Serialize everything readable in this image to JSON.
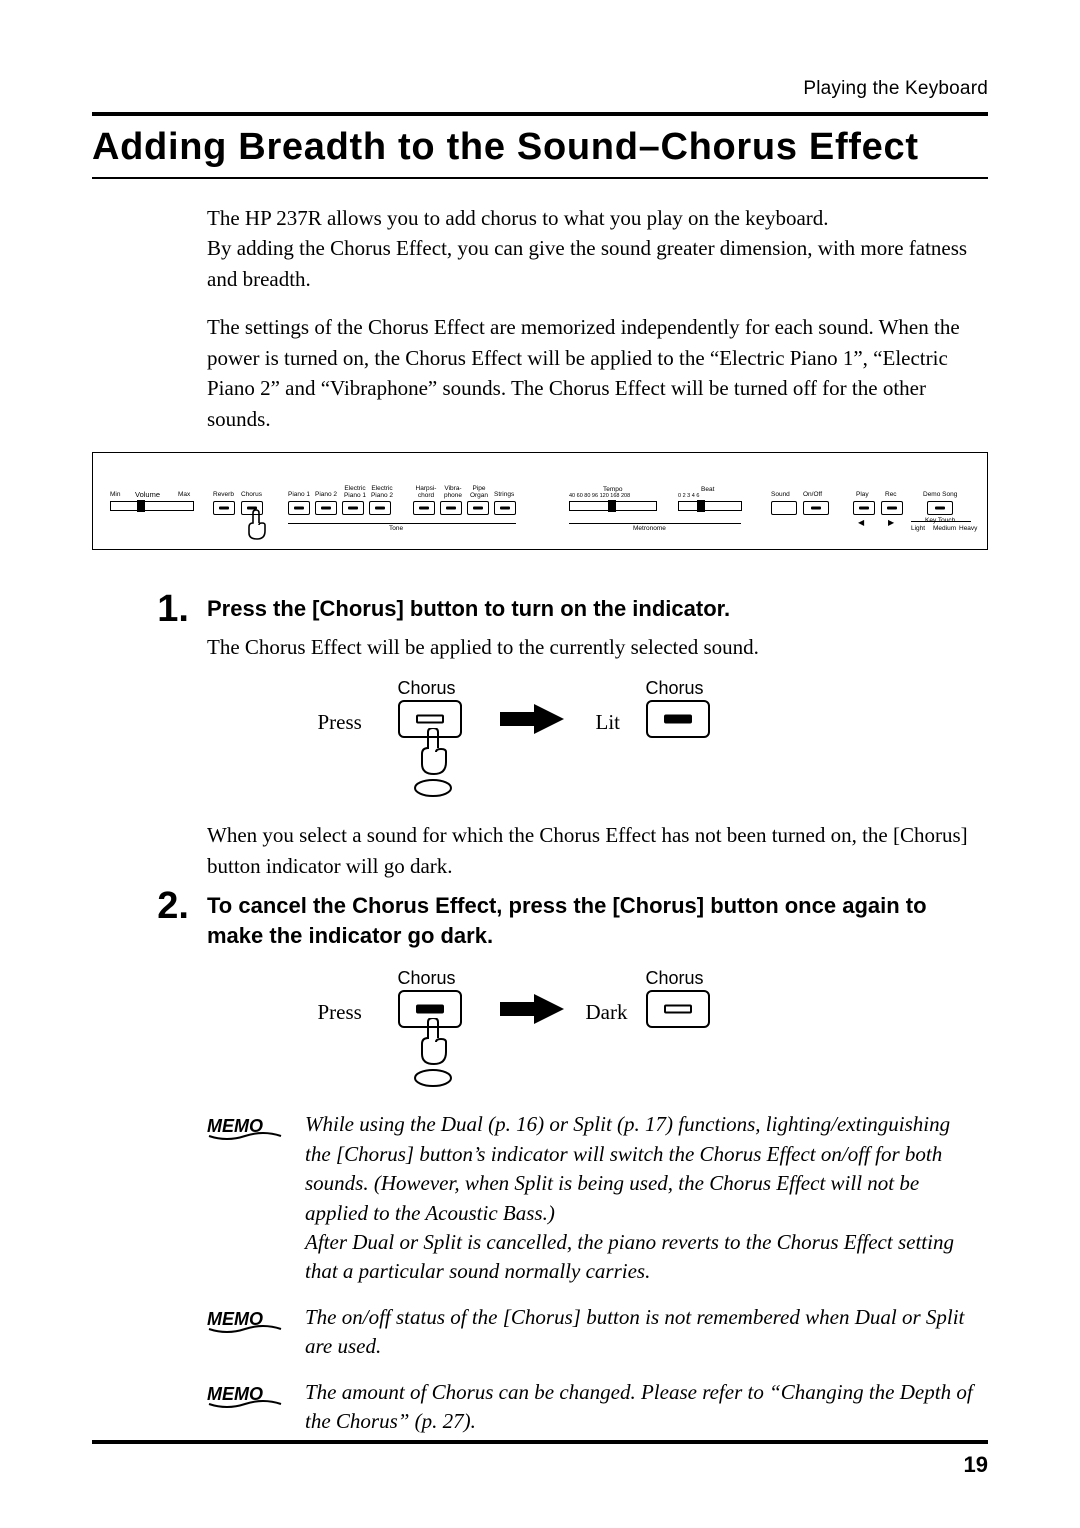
{
  "header": {
    "running": "Playing the Keyboard"
  },
  "title": "Adding Breadth to the Sound–Chorus Effect",
  "intro": {
    "p1": "The HP 237R allows you to add chorus to what you play on the keyboard.\nBy adding the Chorus Effect, you can give the sound greater dimension, with more fatness and breadth.",
    "p2": "The settings of the Chorus Effect are memorized independently for each sound. When the power is turned on, the Chorus Effect will be applied to the “Electric Piano 1”, “Electric Piano 2” and “Vibraphone” sounds. The Chorus Effect will be turned off for the other sounds."
  },
  "panel": {
    "volume": {
      "label": "Volume",
      "min": "Min",
      "max": "Max"
    },
    "reverb": "Reverb",
    "chorus": "Chorus",
    "tone_group": "Tone",
    "tones": [
      "Piano 1",
      "Piano 2",
      "Electric Piano 1",
      "Electric Piano 2",
      "Harpsi-chord",
      "Vibra-phone",
      "Pipe Organ",
      "Strings"
    ],
    "tempo": {
      "label": "Tempo",
      "ticks": "40 60 80 96 120 168 208"
    },
    "beat": {
      "label": "Beat",
      "ticks": "0 2 3 4 6"
    },
    "metronome": "Metronome",
    "sound": "Sound",
    "onoff": "On/Off",
    "play": "Play",
    "rec": "Rec",
    "demo": "Demo Song",
    "keytouch": {
      "label": "Key Touch",
      "levels": [
        "Light",
        "Medium",
        "Heavy"
      ]
    },
    "transport": {
      "bwd": "◀",
      "fwd": "▶"
    }
  },
  "steps": {
    "s1": {
      "num": "1.",
      "head": "Press the [Chorus] button to turn on the indicator.",
      "text": "The Chorus Effect will be applied to the currently selected sound.",
      "fig": {
        "chorus_label_left": "Chorus",
        "chorus_label_right": "Chorus",
        "press": "Press",
        "result": "Lit"
      },
      "after": "When you select a sound for which the Chorus Effect has not been turned on, the [Chorus] button indicator will go dark."
    },
    "s2": {
      "num": "2.",
      "head": "To cancel the Chorus Effect, press the [Chorus] button once again to make the indicator go dark.",
      "fig": {
        "chorus_label_left": "Chorus",
        "chorus_label_right": "Chorus",
        "press": "Press",
        "result": "Dark"
      }
    }
  },
  "memos": {
    "badge": "MEMO",
    "m1": "While using the Dual (p. 16) or Split (p. 17) functions, lighting/extinguishing the [Chorus] button’s indicator will switch the Chorus Effect on/off for both sounds. (However, when Split is being used, the Chorus Effect will not be applied to the Acoustic Bass.)\nAfter Dual or Split is cancelled, the piano reverts to the Chorus Effect setting that a particular sound normally carries.",
    "m2": "The on/off status of the [Chorus] button is not remembered when Dual or Split are used.",
    "m3": "The amount of Chorus can be changed. Please refer to “Changing the Depth of the Chorus” (p. 27)."
  },
  "footer": {
    "page": "19"
  }
}
